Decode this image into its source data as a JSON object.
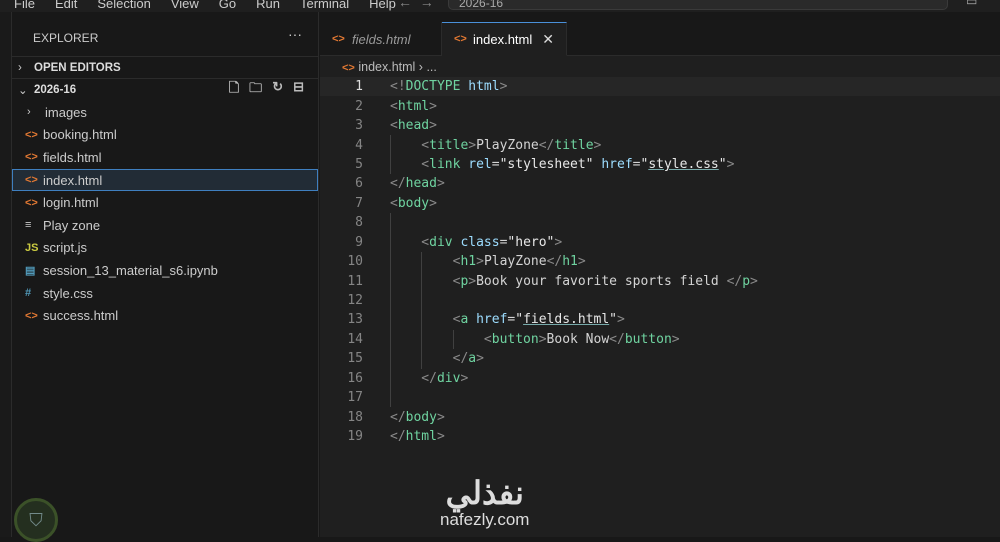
{
  "menu": [
    "File",
    "Edit",
    "Selection",
    "View",
    "Go",
    "Run",
    "Terminal",
    "Help"
  ],
  "command_center": "2026-16",
  "sidebar": {
    "title": "EXPLORER",
    "open_editors": "OPEN EDITORS",
    "root": "2026-16",
    "items": [
      {
        "label": "images",
        "type": "folder"
      },
      {
        "label": "booking.html",
        "type": "html"
      },
      {
        "label": "fields.html",
        "type": "html"
      },
      {
        "label": "index.html",
        "type": "html",
        "selected": true
      },
      {
        "label": "login.html",
        "type": "html"
      },
      {
        "label": "Play zone",
        "type": "txt"
      },
      {
        "label": "script.js",
        "type": "js"
      },
      {
        "label": "session_13_material_s6.ipynb",
        "type": "nb"
      },
      {
        "label": "style.css",
        "type": "css"
      },
      {
        "label": "success.html",
        "type": "html"
      }
    ]
  },
  "tabs": [
    {
      "label": "fields.html",
      "active": false
    },
    {
      "label": "index.html",
      "active": true
    }
  ],
  "breadcrumb": {
    "file": "index.html",
    "rest": "..."
  },
  "code": [
    {
      "n": "1",
      "indent": 0,
      "tokens": [
        [
          "<!",
          "b"
        ],
        [
          "DOCTYPE",
          "t"
        ],
        [
          " html",
          "a"
        ],
        [
          ">",
          "b"
        ]
      ]
    },
    {
      "n": "2",
      "indent": 0,
      "tokens": [
        [
          "<",
          "b"
        ],
        [
          "html",
          "t"
        ],
        [
          ">",
          "b"
        ]
      ]
    },
    {
      "n": "3",
      "indent": 0,
      "tokens": [
        [
          "<",
          "b"
        ],
        [
          "head",
          "t"
        ],
        [
          ">",
          "b"
        ]
      ]
    },
    {
      "n": "4",
      "indent": 1,
      "tokens": [
        [
          "    <",
          "b"
        ],
        [
          "title",
          "t"
        ],
        [
          ">",
          "b"
        ],
        [
          "PlayZone",
          "p"
        ],
        [
          "</",
          "b"
        ],
        [
          "title",
          "t"
        ],
        [
          ">",
          "b"
        ]
      ]
    },
    {
      "n": "5",
      "indent": 1,
      "tokens": [
        [
          "    <",
          "b"
        ],
        [
          "link",
          "t"
        ],
        [
          " rel",
          "a"
        ],
        [
          "=",
          "p"
        ],
        [
          "\"stylesheet\"",
          "s"
        ],
        [
          " href",
          "a"
        ],
        [
          "=",
          "p"
        ],
        [
          "\"",
          "s"
        ],
        [
          "style.css",
          "su"
        ],
        [
          "\"",
          "s"
        ],
        [
          ">",
          "b"
        ]
      ]
    },
    {
      "n": "6",
      "indent": 0,
      "tokens": [
        [
          "</",
          "b"
        ],
        [
          "head",
          "t"
        ],
        [
          ">",
          "b"
        ]
      ]
    },
    {
      "n": "7",
      "indent": 0,
      "tokens": [
        [
          "<",
          "b"
        ],
        [
          "body",
          "t"
        ],
        [
          ">",
          "b"
        ]
      ]
    },
    {
      "n": "8",
      "indent": 1,
      "tokens": []
    },
    {
      "n": "9",
      "indent": 1,
      "tokens": [
        [
          "    <",
          "b"
        ],
        [
          "div",
          "t"
        ],
        [
          " class",
          "a"
        ],
        [
          "=",
          "p"
        ],
        [
          "\"hero\"",
          "s"
        ],
        [
          ">",
          "b"
        ]
      ]
    },
    {
      "n": "10",
      "indent": 2,
      "tokens": [
        [
          "        <",
          "b"
        ],
        [
          "h1",
          "t"
        ],
        [
          ">",
          "b"
        ],
        [
          "PlayZone",
          "p"
        ],
        [
          "</",
          "b"
        ],
        [
          "h1",
          "t"
        ],
        [
          ">",
          "b"
        ]
      ]
    },
    {
      "n": "11",
      "indent": 2,
      "tokens": [
        [
          "        <",
          "b"
        ],
        [
          "p",
          "t"
        ],
        [
          ">",
          "b"
        ],
        [
          "Book your favorite sports field ",
          "p"
        ],
        [
          "</",
          "b"
        ],
        [
          "p",
          "t"
        ],
        [
          ">",
          "b"
        ]
      ]
    },
    {
      "n": "12",
      "indent": 2,
      "tokens": []
    },
    {
      "n": "13",
      "indent": 2,
      "tokens": [
        [
          "        <",
          "b"
        ],
        [
          "a",
          "t"
        ],
        [
          " href",
          "a"
        ],
        [
          "=",
          "p"
        ],
        [
          "\"",
          "s"
        ],
        [
          "fields.html",
          "su"
        ],
        [
          "\"",
          "s"
        ],
        [
          ">",
          "b"
        ]
      ]
    },
    {
      "n": "14",
      "indent": 3,
      "tokens": [
        [
          "            <",
          "b"
        ],
        [
          "button",
          "t"
        ],
        [
          ">",
          "b"
        ],
        [
          "Book Now",
          "p"
        ],
        [
          "</",
          "b"
        ],
        [
          "button",
          "t"
        ],
        [
          ">",
          "b"
        ]
      ]
    },
    {
      "n": "15",
      "indent": 2,
      "tokens": [
        [
          "        </",
          "b"
        ],
        [
          "a",
          "t"
        ],
        [
          ">",
          "b"
        ]
      ]
    },
    {
      "n": "16",
      "indent": 1,
      "tokens": [
        [
          "    </",
          "b"
        ],
        [
          "div",
          "t"
        ],
        [
          ">",
          "b"
        ]
      ]
    },
    {
      "n": "17",
      "indent": 1,
      "tokens": []
    },
    {
      "n": "18",
      "indent": 0,
      "tokens": [
        [
          "</",
          "b"
        ],
        [
          "body",
          "t"
        ],
        [
          ">",
          "b"
        ]
      ]
    },
    {
      "n": "19",
      "indent": 0,
      "tokens": [
        [
          "</",
          "b"
        ],
        [
          "html",
          "t"
        ],
        [
          ">",
          "b"
        ]
      ]
    }
  ],
  "watermark": {
    "arabic": "نفذلي",
    "site": "nafezly.com"
  }
}
